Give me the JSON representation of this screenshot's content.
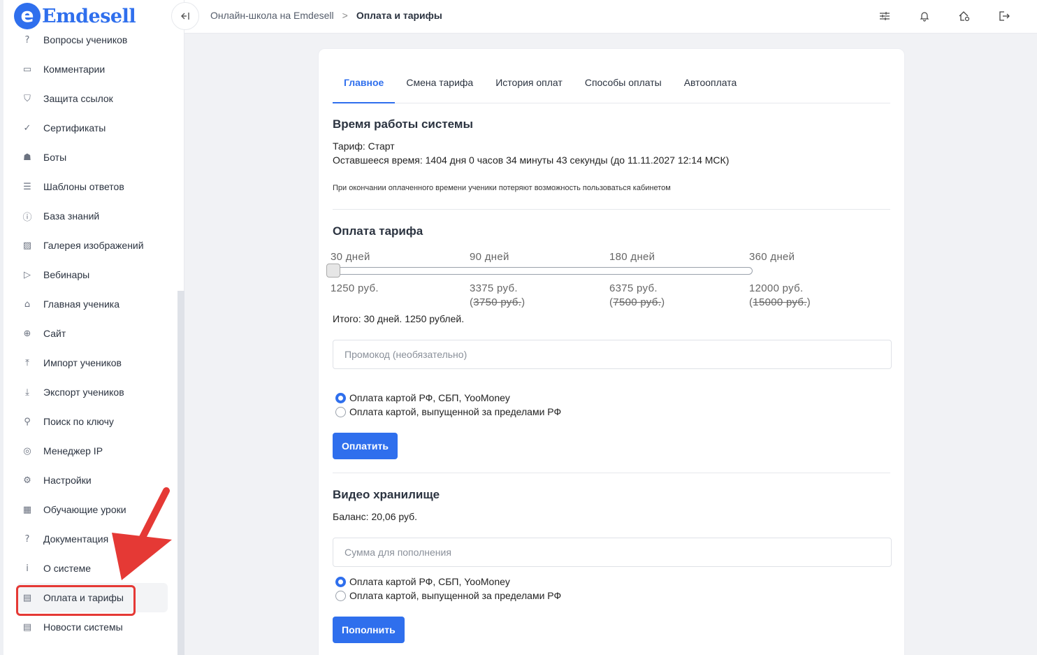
{
  "app": {
    "logo_letter": "e",
    "logo_text": "Emdesell",
    "brand_color": "#2f6fed"
  },
  "sidebar": {
    "items": [
      {
        "label": "Вопросы учеников",
        "icon": "question-circle-icon",
        "glyph": "?"
      },
      {
        "label": "Комментарии",
        "icon": "comment-icon",
        "glyph": "▭"
      },
      {
        "label": "Защита ссылок",
        "icon": "shield-icon",
        "glyph": "⛉"
      },
      {
        "label": "Сертификаты",
        "icon": "check-circle-icon",
        "glyph": "✓"
      },
      {
        "label": "Боты",
        "icon": "robot-icon",
        "glyph": "☗"
      },
      {
        "label": "Шаблоны ответов",
        "icon": "list-icon",
        "glyph": "☰"
      },
      {
        "label": "База знаний",
        "icon": "info-circle-icon",
        "glyph": "ⓘ"
      },
      {
        "label": "Галерея изображений",
        "icon": "image-icon",
        "glyph": "▨"
      },
      {
        "label": "Вебинары",
        "icon": "play-icon",
        "glyph": "▷"
      },
      {
        "label": "Главная ученика",
        "icon": "home-icon",
        "glyph": "⌂"
      },
      {
        "label": "Сайт",
        "icon": "globe-icon",
        "glyph": "⊕"
      },
      {
        "label": "Импорт учеников",
        "icon": "upload-icon",
        "glyph": "⤒"
      },
      {
        "label": "Экспорт учеников",
        "icon": "download-icon",
        "glyph": "⤓"
      },
      {
        "label": "Поиск по ключу",
        "icon": "search-icon",
        "glyph": "⚲"
      },
      {
        "label": "Менеджер IP",
        "icon": "target-icon",
        "glyph": "◎"
      },
      {
        "label": "Настройки",
        "icon": "gear-icon",
        "glyph": "⚙"
      },
      {
        "label": "Обучающие уроки",
        "icon": "film-icon",
        "glyph": "▦"
      },
      {
        "label": "Документация",
        "icon": "question-square-icon",
        "glyph": "?"
      },
      {
        "label": "О системе",
        "icon": "info-square-icon",
        "glyph": "i"
      },
      {
        "label": "Оплата и тарифы",
        "icon": "receipt-icon",
        "glyph": "▤"
      },
      {
        "label": "Новости системы",
        "icon": "newspaper-icon",
        "glyph": "▤"
      }
    ],
    "active_index": 19
  },
  "header": {
    "breadcrumb_root": "Онлайн-школа на Emdesell",
    "breadcrumb_sep": ">",
    "breadcrumb_current": "Оплата и тарифы",
    "icons": [
      "sliders-icon",
      "bell-icon",
      "home-gear-icon",
      "logout-icon"
    ]
  },
  "tabs": [
    {
      "label": "Главное",
      "active": true
    },
    {
      "label": "Смена тарифа",
      "active": false
    },
    {
      "label": "История оплат",
      "active": false
    },
    {
      "label": "Способы оплаты",
      "active": false
    },
    {
      "label": "Автооплата",
      "active": false
    }
  ],
  "system_time": {
    "title": "Время работы системы",
    "tariff": "Тариф: Старт",
    "remaining": "Оставшееся время: 1404 дня 0 часов 34 минуты 43 секунды (до 11.11.2027 12:14 МСК)",
    "note": "При окончании оплаченного времени ученики потеряют возможность пользоваться кабинетом"
  },
  "tariff_payment": {
    "title": "Оплата тарифа",
    "options": [
      {
        "days": "30 дней",
        "price": "1250 руб.",
        "old_price": ""
      },
      {
        "days": "90 дней",
        "price": "3375 руб.",
        "old_price": "3750 руб."
      },
      {
        "days": "180 дней",
        "price": "6375 руб.",
        "old_price": "7500 руб."
      },
      {
        "days": "360 дней",
        "price": "12000 руб.",
        "old_price": "15000 руб."
      }
    ],
    "slider_index": 0,
    "total": "Итого: 30 дней. 1250 рублей.",
    "promo_placeholder": "Промокод (необязательно)",
    "methods": [
      {
        "label": "Оплата картой РФ, СБП, YooMoney",
        "checked": true
      },
      {
        "label": "Оплата картой, выпущенной за пределами РФ",
        "checked": false
      }
    ],
    "pay_button": "Оплатить"
  },
  "video_storage": {
    "title": "Видео хранилище",
    "balance": "Баланс: 20,06 руб.",
    "amount_placeholder": "Сумма для пополнения",
    "methods": [
      {
        "label": "Оплата картой РФ, СБП, YooMoney",
        "checked": true
      },
      {
        "label": "Оплата картой, выпущенной за пределами РФ",
        "checked": false
      }
    ],
    "topup_button": "Пополнить"
  },
  "annotation": {
    "color": "#e53935"
  }
}
